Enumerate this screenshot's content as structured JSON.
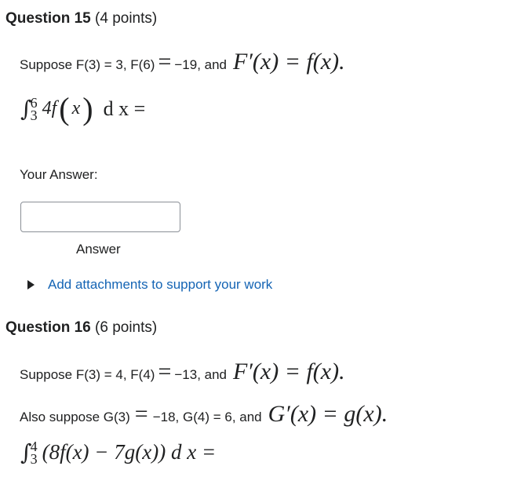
{
  "q15": {
    "title": "Question 15",
    "points": "(4 points)",
    "given_text": "Suppose F(3) = 3, F(6)",
    "eq": "=",
    "value": "−19, and",
    "relation": "F′(x) = f(x).",
    "integral": {
      "upper": "6",
      "lower": "3",
      "body": "4f",
      "lparen": "(",
      "var": "x",
      "rparen": ")",
      "dx": "d x =",
      "symbol": "∫"
    },
    "answer_label": "Your Answer:",
    "answer_value": "",
    "answer_caption": "Answer",
    "attach_link": "Add attachments to support your work"
  },
  "q16": {
    "title": "Question 16",
    "points": "(6 points)",
    "given_text": "Suppose F(3) = 4, F(4)",
    "eq": "=",
    "value": "−13, and",
    "relation": "F′(x) = f(x).",
    "also_text": "Also suppose G(3)",
    "also_eq": "=",
    "also_value": "−18, G(4) = 6, and",
    "also_relation": "G′(x) = g(x).",
    "integral": {
      "upper": "4",
      "lower": "3",
      "body": "(8f(x) − 7g(x)) d x =",
      "symbol": "∫"
    }
  }
}
